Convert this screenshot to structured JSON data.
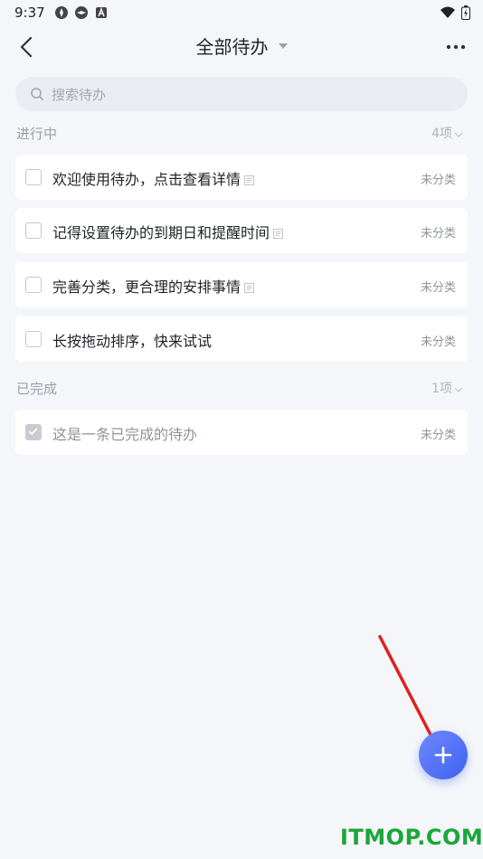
{
  "status_bar": {
    "time": "9:37"
  },
  "header": {
    "title": "全部待办"
  },
  "search": {
    "placeholder": "搜索待办"
  },
  "sections": {
    "in_progress": {
      "label": "进行中",
      "count": "4项",
      "items": [
        {
          "text": "欢迎使用待办，点击查看详情",
          "category": "未分类",
          "has_note": true
        },
        {
          "text": "记得设置待办的到期日和提醒时间",
          "category": "未分类",
          "has_note": true
        },
        {
          "text": "完善分类，更合理的安排事情",
          "category": "未分类",
          "has_note": true
        },
        {
          "text": "长按拖动排序，快来试试",
          "category": "未分类",
          "has_note": false
        }
      ]
    },
    "completed": {
      "label": "已完成",
      "count": "1项",
      "items": [
        {
          "text": "这是一条已完成的待办",
          "category": "未分类",
          "has_note": false
        }
      ]
    }
  },
  "watermark": "ITMOP.COM",
  "colors": {
    "accent": "#4a6cf7",
    "background": "#f5f6fa",
    "annotation_arrow": "#e02020",
    "watermark": "#1aa63a"
  },
  "icons": [
    "back-arrow-icon",
    "caret-down-icon",
    "more-icon",
    "search-icon",
    "checkbox-icon",
    "note-icon",
    "plus-icon",
    "chevron-down-icon"
  ]
}
